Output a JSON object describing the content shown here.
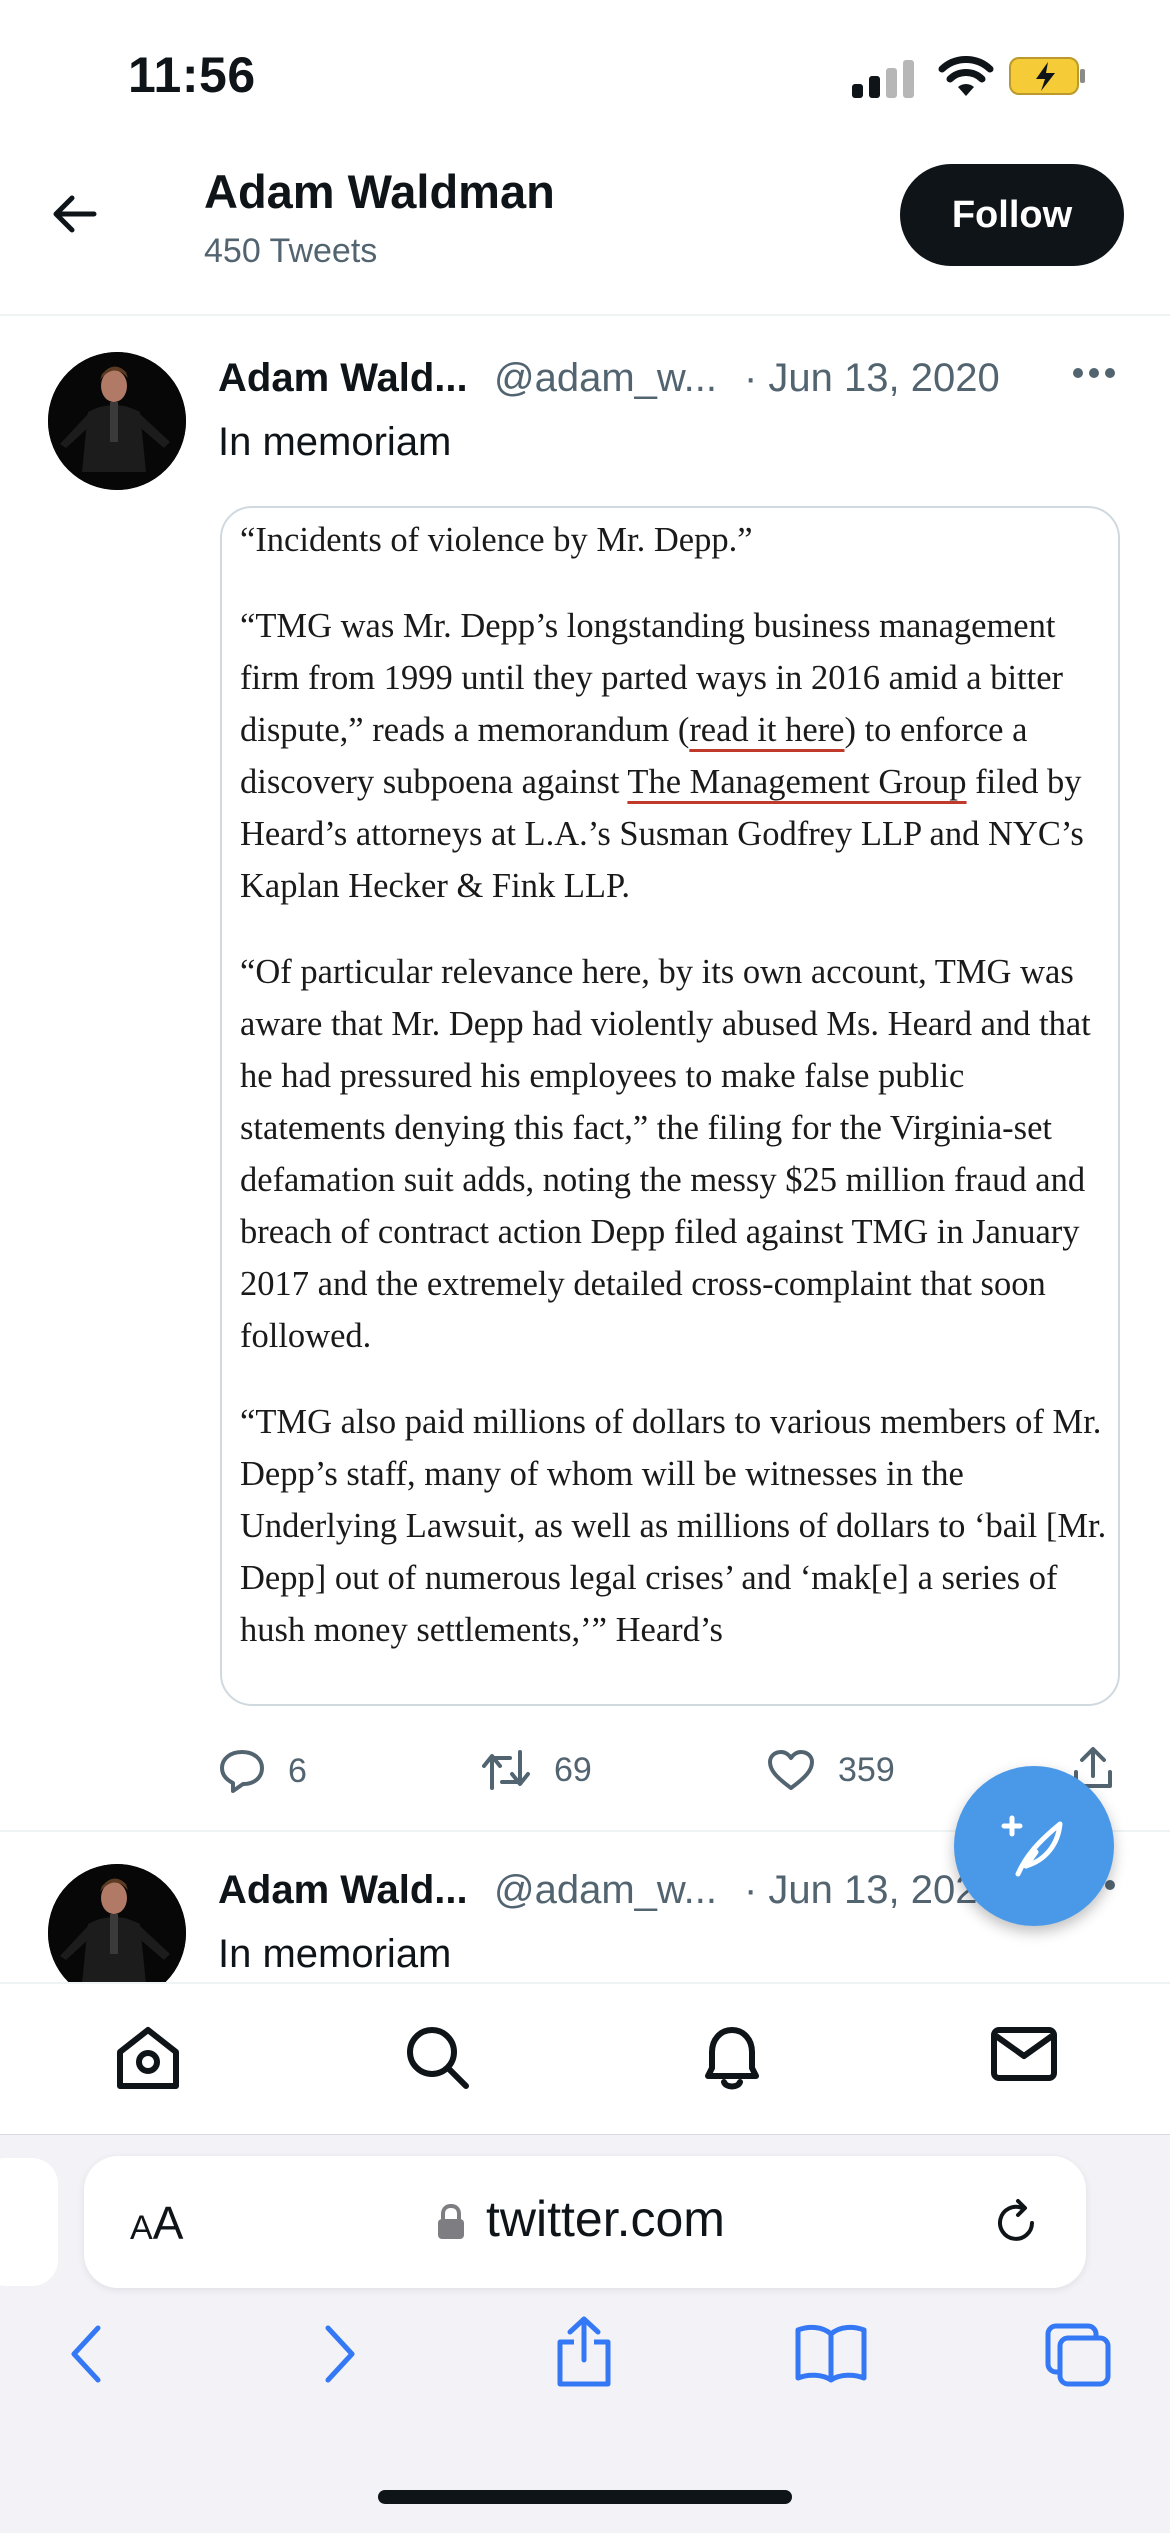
{
  "status_bar": {
    "time": "11:56",
    "icons": [
      "cellular-signal-icon",
      "wifi-icon",
      "battery-charging-icon"
    ]
  },
  "header": {
    "name": "Adam Waldman",
    "tweet_count": "450 Tweets",
    "follow_label": "Follow"
  },
  "tweets": [
    {
      "name": "Adam Wald...",
      "handle": "@adam_w...",
      "date": "· Jun 13, 2020",
      "text": "In memoriam",
      "article": {
        "p1": "“Incidents of violence by Mr. Depp.”",
        "p2_a": "“TMG was Mr. Depp’s longstanding business management firm from 1999 until they parted ways in 2016 amid a bitter dispute,” reads a memorandum (",
        "p2_link1": "read it here",
        "p2_b": ") to enforce a discovery subpoena against ",
        "p2_link2": "The Management Group",
        "p2_c": " filed by Heard’s attorneys at L.A.’s Susman Godfrey LLP and NYC’s Kaplan Hecker & Fink LLP.",
        "p3": "“Of particular relevance here, by its own account, TMG was aware that Mr. Depp had violently abused Ms. Heard and that he had pressured his employees to make false public statements denying this fact,” the filing for the Virginia-set defamation suit adds, noting the messy $25 million fraud and breach of contract action Depp filed against TMG in January 2017 and the extremely detailed cross-complaint that soon followed.",
        "p4": "“TMG also paid millions of dollars to various members of Mr. Depp’s staff, many of whom will be witnesses in the Underlying Lawsuit, as well as millions of dollars to ‘bail [Mr. Depp] out of numerous legal crises’ and ‘mak[e] a series of hush money settlements,’” Heard’s"
      },
      "replies": "6",
      "retweets": "69",
      "likes": "359"
    },
    {
      "name": "Adam Wald...",
      "handle": "@adam_w...",
      "date": "· Jun 13, 2020",
      "text": "In memoriam"
    }
  ],
  "bottom_nav": [
    "home-icon",
    "search-icon",
    "notifications-icon",
    "messages-icon"
  ],
  "browser": {
    "aa_label_big": "A",
    "aa_label_small": "A",
    "url": "twitter.com"
  },
  "colors": {
    "accent": "#4a99e9",
    "safari_blue": "#3478f6",
    "text_secondary": "#536471",
    "charging": "#f5cb38"
  }
}
